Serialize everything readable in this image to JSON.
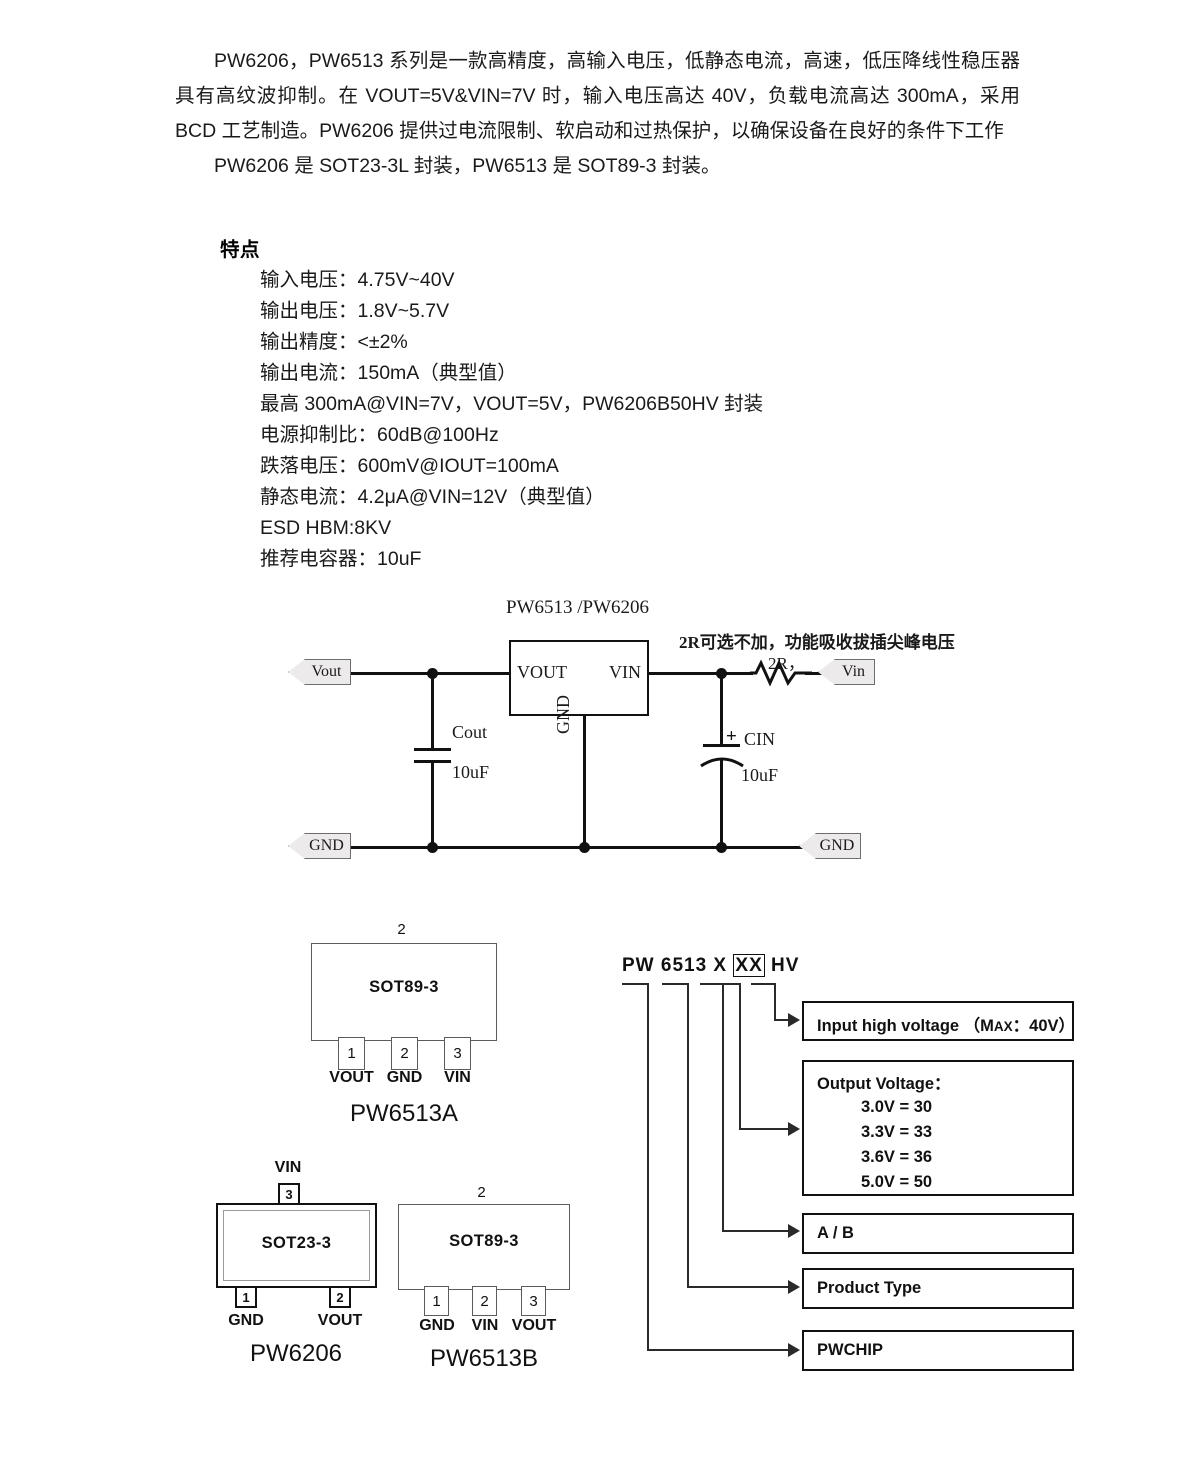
{
  "intro": {
    "paragraph1": "PW6206，PW6513 系列是一款高精度，高输入电压，低静态电流，高速，低压降线性稳压器具有高纹波抑制。在 VOUT=5V&VIN=7V 时，输入电压高达 40V，负载电流高达 300mA，采用 BCD 工艺制造。PW6206 提供过电流限制、软启动和过热保护，以确保设备在良好的条件下工作",
    "paragraph2": "PW6206 是 SOT23-3L 封装，PW6513 是 SOT89-3 封装。"
  },
  "features": {
    "title": "特点",
    "items": [
      "输入电压：4.75V~40V",
      "输出电压：1.8V~5.7V",
      "输出精度：<±2%",
      "输出电流：150mA（典型值）",
      "最高 300mA@VIN=7V，VOUT=5V，PW6206B50HV 封装",
      "电源抑制比：60dB@100Hz",
      "跌落电压：600mV@IOUT=100mA",
      "静态电流：4.2μA@VIN=12V（典型值）",
      "ESD HBM:8KV",
      "推荐电容器：10uF"
    ]
  },
  "circuit": {
    "title": "PW6513 /PW6206",
    "note": "2R可选不加，功能吸收拔插尖峰电压",
    "resistor_label": "2R，",
    "ic": {
      "pin_vout": "VOUT",
      "pin_gnd": "GND",
      "pin_vin": "VIN"
    },
    "ports": {
      "vout": "Vout",
      "vin": "Vin",
      "gnd_left": "GND",
      "gnd_right": "GND"
    },
    "cout": {
      "name": "Cout",
      "value": "10uF"
    },
    "cin": {
      "name": "CIN",
      "value": "10uF",
      "polarity": "+"
    }
  },
  "packages": [
    {
      "id": "pw6513a",
      "caption": "PW6513A",
      "body_label": "SOT89-3",
      "top_pin_number": "2",
      "pins": [
        {
          "number": "1",
          "label": "VOUT"
        },
        {
          "number": "2",
          "label": "GND"
        },
        {
          "number": "3",
          "label": "VIN"
        }
      ]
    },
    {
      "id": "pw6206",
      "caption": "PW6206",
      "body_label": "SOT23-3",
      "top_pin_number": "3",
      "top_pin_label": "VIN",
      "pins": [
        {
          "number": "1",
          "label": "GND"
        },
        {
          "number": "2",
          "label": "VOUT"
        }
      ]
    },
    {
      "id": "pw6513b",
      "caption": "PW6513B",
      "body_label": "SOT89-3",
      "top_pin_number": "2",
      "pins": [
        {
          "number": "1",
          "label": "GND"
        },
        {
          "number": "2",
          "label": "VIN"
        },
        {
          "number": "3",
          "label": "VOUT"
        }
      ]
    }
  ],
  "ordering": {
    "code_prefix": "PW 6513 X ",
    "code_boxed": "XX",
    "code_suffix": " HV",
    "boxes": [
      {
        "id": "input-high-voltage",
        "text_main": "Input high voltage （M",
        "text_sc": "AX",
        "text_tail": "：40V）"
      },
      {
        "id": "output-voltage",
        "title": "Output Voltage：",
        "rows": [
          "3.0V = 30",
          "3.3V = 33",
          "3.6V = 36",
          "5.0V = 50"
        ]
      },
      {
        "id": "ab",
        "text": "A / B"
      },
      {
        "id": "product-type",
        "text": "Product Type"
      },
      {
        "id": "pwchip",
        "text": "PWCHIP"
      }
    ]
  }
}
